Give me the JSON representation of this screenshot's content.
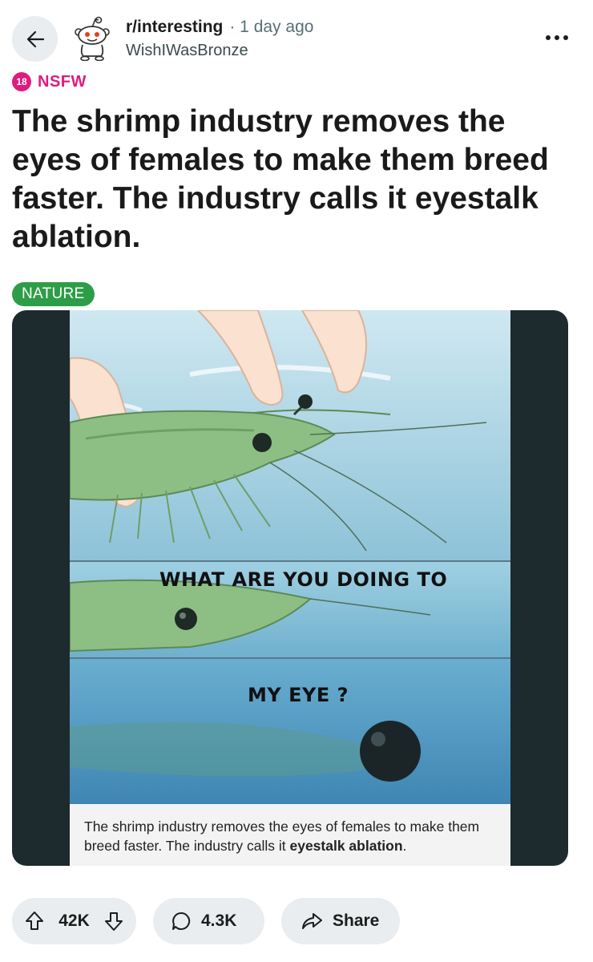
{
  "header": {
    "subreddit": "r/interesting",
    "time_ago": "· 1 day ago",
    "username": "WishIWasBronze",
    "icons": {
      "back": "arrow-left-icon",
      "avatar": "snoo-avatar-icon",
      "more": "ellipsis-icon"
    }
  },
  "post": {
    "nsfw_number": "18",
    "nsfw_label": "NSFW",
    "title": "The shrimp industry removes the eyes of females to make them breed faster. The industry calls it eyestalk ablation.",
    "flair": "NATURE",
    "flair_color": "#2d9e47"
  },
  "media": {
    "bubble_1": "WHAT ARE YOU DOING TO",
    "bubble_2": "MY EYE ?",
    "caption_prefix": "The shrimp industry removes the eyes of females to make them breed faster. The industry calls it",
    "caption_bold": "eyestalk ablation",
    "caption_suffix": "."
  },
  "actions": {
    "votes": "42K",
    "comments": "4.3K",
    "share": "Share",
    "icons": {
      "upvote": "arrow-up-icon",
      "downvote": "arrow-down-icon",
      "comment": "speech-bubble-icon",
      "share": "share-arrow-icon"
    }
  },
  "colors": {
    "nsfw": "#e01b7e",
    "pill_bg": "#e9edef",
    "meta_text": "#576f76"
  }
}
